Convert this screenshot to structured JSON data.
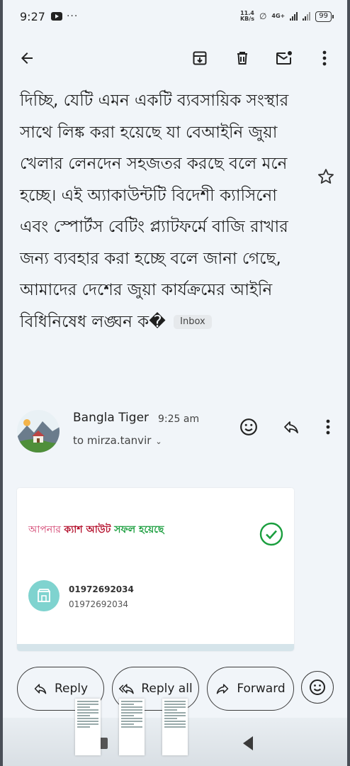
{
  "status_bar": {
    "time": "9:27",
    "more": "···",
    "speed_value": "11.4",
    "speed_unit": "KB/s",
    "network": "4G+",
    "battery": "99"
  },
  "message": {
    "body_text": "দিচ্ছি, যেটি এমন একটি ব্যবসায়িক সংস্থার সাথে লিঙ্ক করা হয়েছে যা বেআইনি জুয়া খেলার লেনদেন সহজতর করছে বলে মনে হচ্ছে। এই অ্যাকাউন্টটি বিদেশী ক্যাসিনো এবং স্পোর্টস বেটিং প্ল্যাটফর্মে বাজি রাখার জন্য ব্যবহার করা হচ্ছে বলে জানা গেছে, আমাদের দেশের জুয়া কার্যক্রমের আইনি বিধিনিষেধ লঙ্ঘন ক�",
    "label": "Inbox"
  },
  "sender": {
    "name": "Bangla Tiger",
    "time": "9:25 am",
    "to": "to mirza.tanvir"
  },
  "attachment_card": {
    "text_part1": "আপনার ",
    "text_part2": "ক্যাশ আউট ",
    "text_part3": "সফল হয়েছে",
    "number_primary": "01972692034",
    "number_secondary": "01972692034",
    "colors": {
      "pink": "#d13b6a",
      "red": "#b5122e",
      "green": "#1a9e3e",
      "teal": "#7fd3cf"
    }
  },
  "actions": {
    "reply": "Reply",
    "reply_all": "Reply all",
    "forward": "Forward"
  },
  "icons": [
    "back-arrow-icon",
    "archive-icon",
    "delete-icon",
    "mark-unread-icon",
    "more-vert-icon",
    "star-icon",
    "emoji-icon",
    "reply-icon",
    "reply-all-icon",
    "forward-icon",
    "check-circle-icon",
    "store-icon"
  ]
}
